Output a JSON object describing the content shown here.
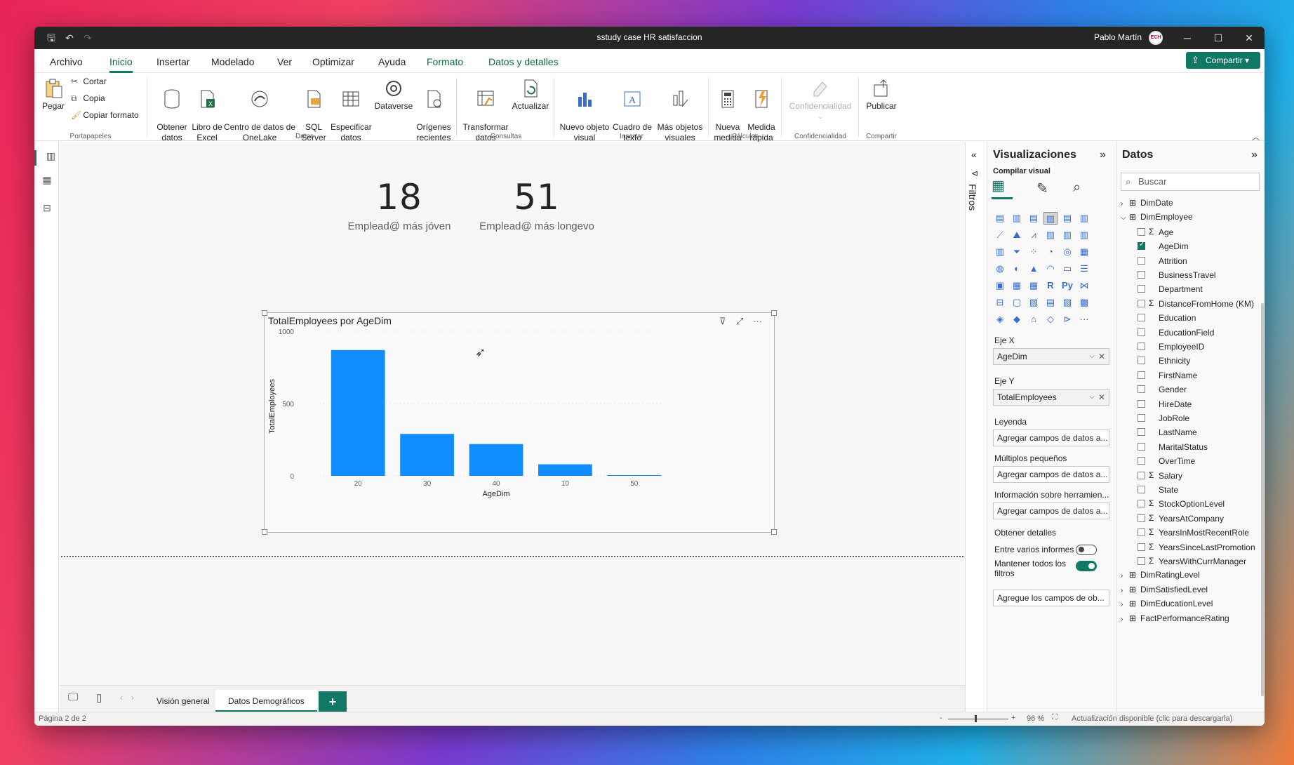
{
  "window": {
    "title": "sstudy case HR satisfaccion",
    "user": "Pablo Martín",
    "avatar_text": "ECH"
  },
  "menu": {
    "items": [
      "Archivo",
      "Inicio",
      "Insertar",
      "Modelado",
      "Ver",
      "Optimizar",
      "Ayuda",
      "Formato",
      "Datos y detalles"
    ],
    "active": "Inicio",
    "share_label": "Compartir"
  },
  "ribbon": {
    "clipboard": {
      "paste": "Pegar",
      "cut": "Cortar",
      "copy": "Copia",
      "format": "Copiar formato",
      "group": "Portapapeles"
    },
    "data": {
      "get_data": "Obtener\ndatos",
      "excel": "Libro de\nExcel",
      "onelake": "Centro de datos de\nOneLake",
      "sql": "SQL\nServer",
      "enter": "Especificar\ndatos",
      "dataverse": "Dataverse",
      "recent": "Orígenes\nrecientes",
      "group": "Datos"
    },
    "queries": {
      "transform": "Transformar\ndatos",
      "refresh": "Actualizar",
      "group": "Consultas"
    },
    "insert": {
      "new_visual": "Nuevo objeto\nvisual",
      "textbox": "Cuadro de\ntexto",
      "more": "Más objetos\nvisuales",
      "group": "Insertar"
    },
    "calc": {
      "new_measure": "Nueva\nmedida",
      "quick_measure": "Medida\nrápida",
      "group": "Cálculos"
    },
    "sensitivity": {
      "label": "Confidencialidad",
      "group": "Confidencialidad"
    },
    "share": {
      "publish": "Publicar",
      "group": "Compartir"
    }
  },
  "kpis": [
    {
      "value": "18",
      "label": "Emplead@ más jóven"
    },
    {
      "value": "51",
      "label": "Emplead@ más longevo"
    }
  ],
  "chart_data": {
    "type": "bar",
    "title": "TotalEmployees por AgeDim",
    "xlabel": "AgeDim",
    "ylabel": "TotalEmployees",
    "categories": [
      "20",
      "30",
      "40",
      "10",
      "50"
    ],
    "values": [
      870,
      290,
      220,
      80,
      5
    ],
    "ylim": [
      0,
      1000
    ],
    "yticks": [
      "1000",
      "500",
      "0"
    ],
    "color": "#118DFF",
    "grid": false
  },
  "pages": {
    "tabs": [
      "Visión general",
      "Datos Demográficos"
    ],
    "selected": "Datos Demográficos",
    "add": "+"
  },
  "status": {
    "page": "Página 2 de 2",
    "zoom": "96 %",
    "update": "Actualización disponible (clic para descargarla)"
  },
  "filters": {
    "label": "Filtros"
  },
  "visualizations": {
    "title": "Visualizaciones",
    "build": "Compilar visual",
    "x_axis": {
      "label": "Eje X",
      "field": "AgeDim"
    },
    "y_axis": {
      "label": "Eje Y",
      "field": "TotalEmployees"
    },
    "legend": {
      "label": "Leyenda",
      "placeholder": "Agregar campos de datos a..."
    },
    "small_multiples": {
      "label": "Múltiplos pequeños",
      "placeholder": "Agregar campos de datos a..."
    },
    "tooltips": {
      "label": "Información sobre herramien...",
      "placeholder": "Agregar campos de datos a..."
    },
    "drillthrough": {
      "label": "Obtener detalles",
      "cross_report": "Entre varios informes",
      "keep_filters": "Mantener todos los filtros",
      "placeholder": "Agregue los campos de ob..."
    },
    "r_label": "R",
    "py_label": "Py",
    "more": "···"
  },
  "data_pane": {
    "title": "Datos",
    "search_placeholder": "Buscar",
    "tables": [
      {
        "name": "DimDate",
        "expanded": false
      },
      {
        "name": "DimEmployee",
        "expanded": true
      }
    ],
    "fields": [
      {
        "name": "Age",
        "sigma": true,
        "checked": false
      },
      {
        "name": "AgeDim",
        "sigma": false,
        "checked": true
      },
      {
        "name": "Attrition",
        "sigma": false,
        "checked": false
      },
      {
        "name": "BusinessTravel",
        "sigma": false,
        "checked": false
      },
      {
        "name": "Department",
        "sigma": false,
        "checked": false
      },
      {
        "name": "DistanceFromHome (KM)",
        "sigma": true,
        "checked": false
      },
      {
        "name": "Education",
        "sigma": false,
        "checked": false
      },
      {
        "name": "EducationField",
        "sigma": false,
        "checked": false
      },
      {
        "name": "EmployeeID",
        "sigma": false,
        "checked": false
      },
      {
        "name": "Ethnicity",
        "sigma": false,
        "checked": false
      },
      {
        "name": "FirstName",
        "sigma": false,
        "checked": false
      },
      {
        "name": "Gender",
        "sigma": false,
        "checked": false
      },
      {
        "name": "HireDate",
        "sigma": false,
        "checked": false
      },
      {
        "name": "JobRole",
        "sigma": false,
        "checked": false
      },
      {
        "name": "LastName",
        "sigma": false,
        "checked": false
      },
      {
        "name": "MaritalStatus",
        "sigma": false,
        "checked": false
      },
      {
        "name": "OverTime",
        "sigma": false,
        "checked": false
      },
      {
        "name": "Salary",
        "sigma": true,
        "checked": false
      },
      {
        "name": "State",
        "sigma": false,
        "checked": false
      },
      {
        "name": "StockOptionLevel",
        "sigma": true,
        "checked": false
      },
      {
        "name": "YearsAtCompany",
        "sigma": true,
        "checked": false
      },
      {
        "name": "YearsInMostRecentRole",
        "sigma": true,
        "checked": false
      },
      {
        "name": "YearsSinceLastPromotion",
        "sigma": true,
        "checked": false
      },
      {
        "name": "YearsWithCurrManager",
        "sigma": true,
        "checked": false
      }
    ],
    "other_tables": [
      "DimRatingLevel",
      "DimSatisfiedLevel",
      "DimEducationLevel",
      "FactPerformanceRating"
    ]
  }
}
